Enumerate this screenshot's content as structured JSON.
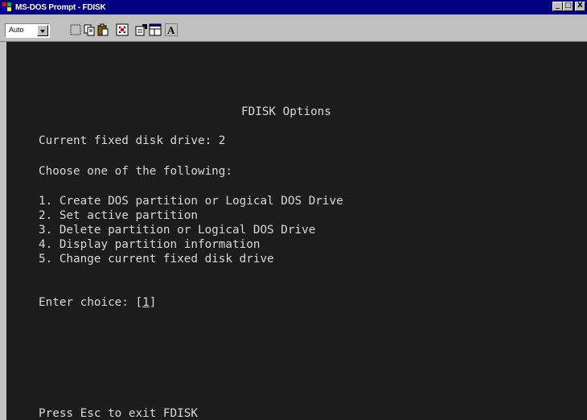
{
  "window": {
    "title": "MS-DOS Prompt - FDISK",
    "buttons": {
      "minimize": "_",
      "maximize": "□",
      "close": "X"
    }
  },
  "toolbar": {
    "font_size": "Auto",
    "icons": [
      "mark-icon",
      "copy-icon",
      "paste-icon",
      "fullscreen-icon",
      "properties-icon",
      "background-icon",
      "font-icon"
    ]
  },
  "console": {
    "heading": "FDISK Options",
    "current_drive": "Current fixed disk drive: 2",
    "prompt": "Choose one of the following:",
    "options": [
      "1. Create DOS partition or Logical DOS Drive",
      "2. Set active partition",
      "3. Delete partition or Logical DOS Drive",
      "4. Display partition information",
      "5. Change current fixed disk drive"
    ],
    "choice_label": "Enter choice: [",
    "choice_value": "1",
    "choice_end": "]",
    "footer": "Press Esc to exit FDISK"
  },
  "colors": {
    "titlebar": "#000080",
    "console_bg": "#1c1c1c",
    "console_text": "#d8d8d8"
  }
}
